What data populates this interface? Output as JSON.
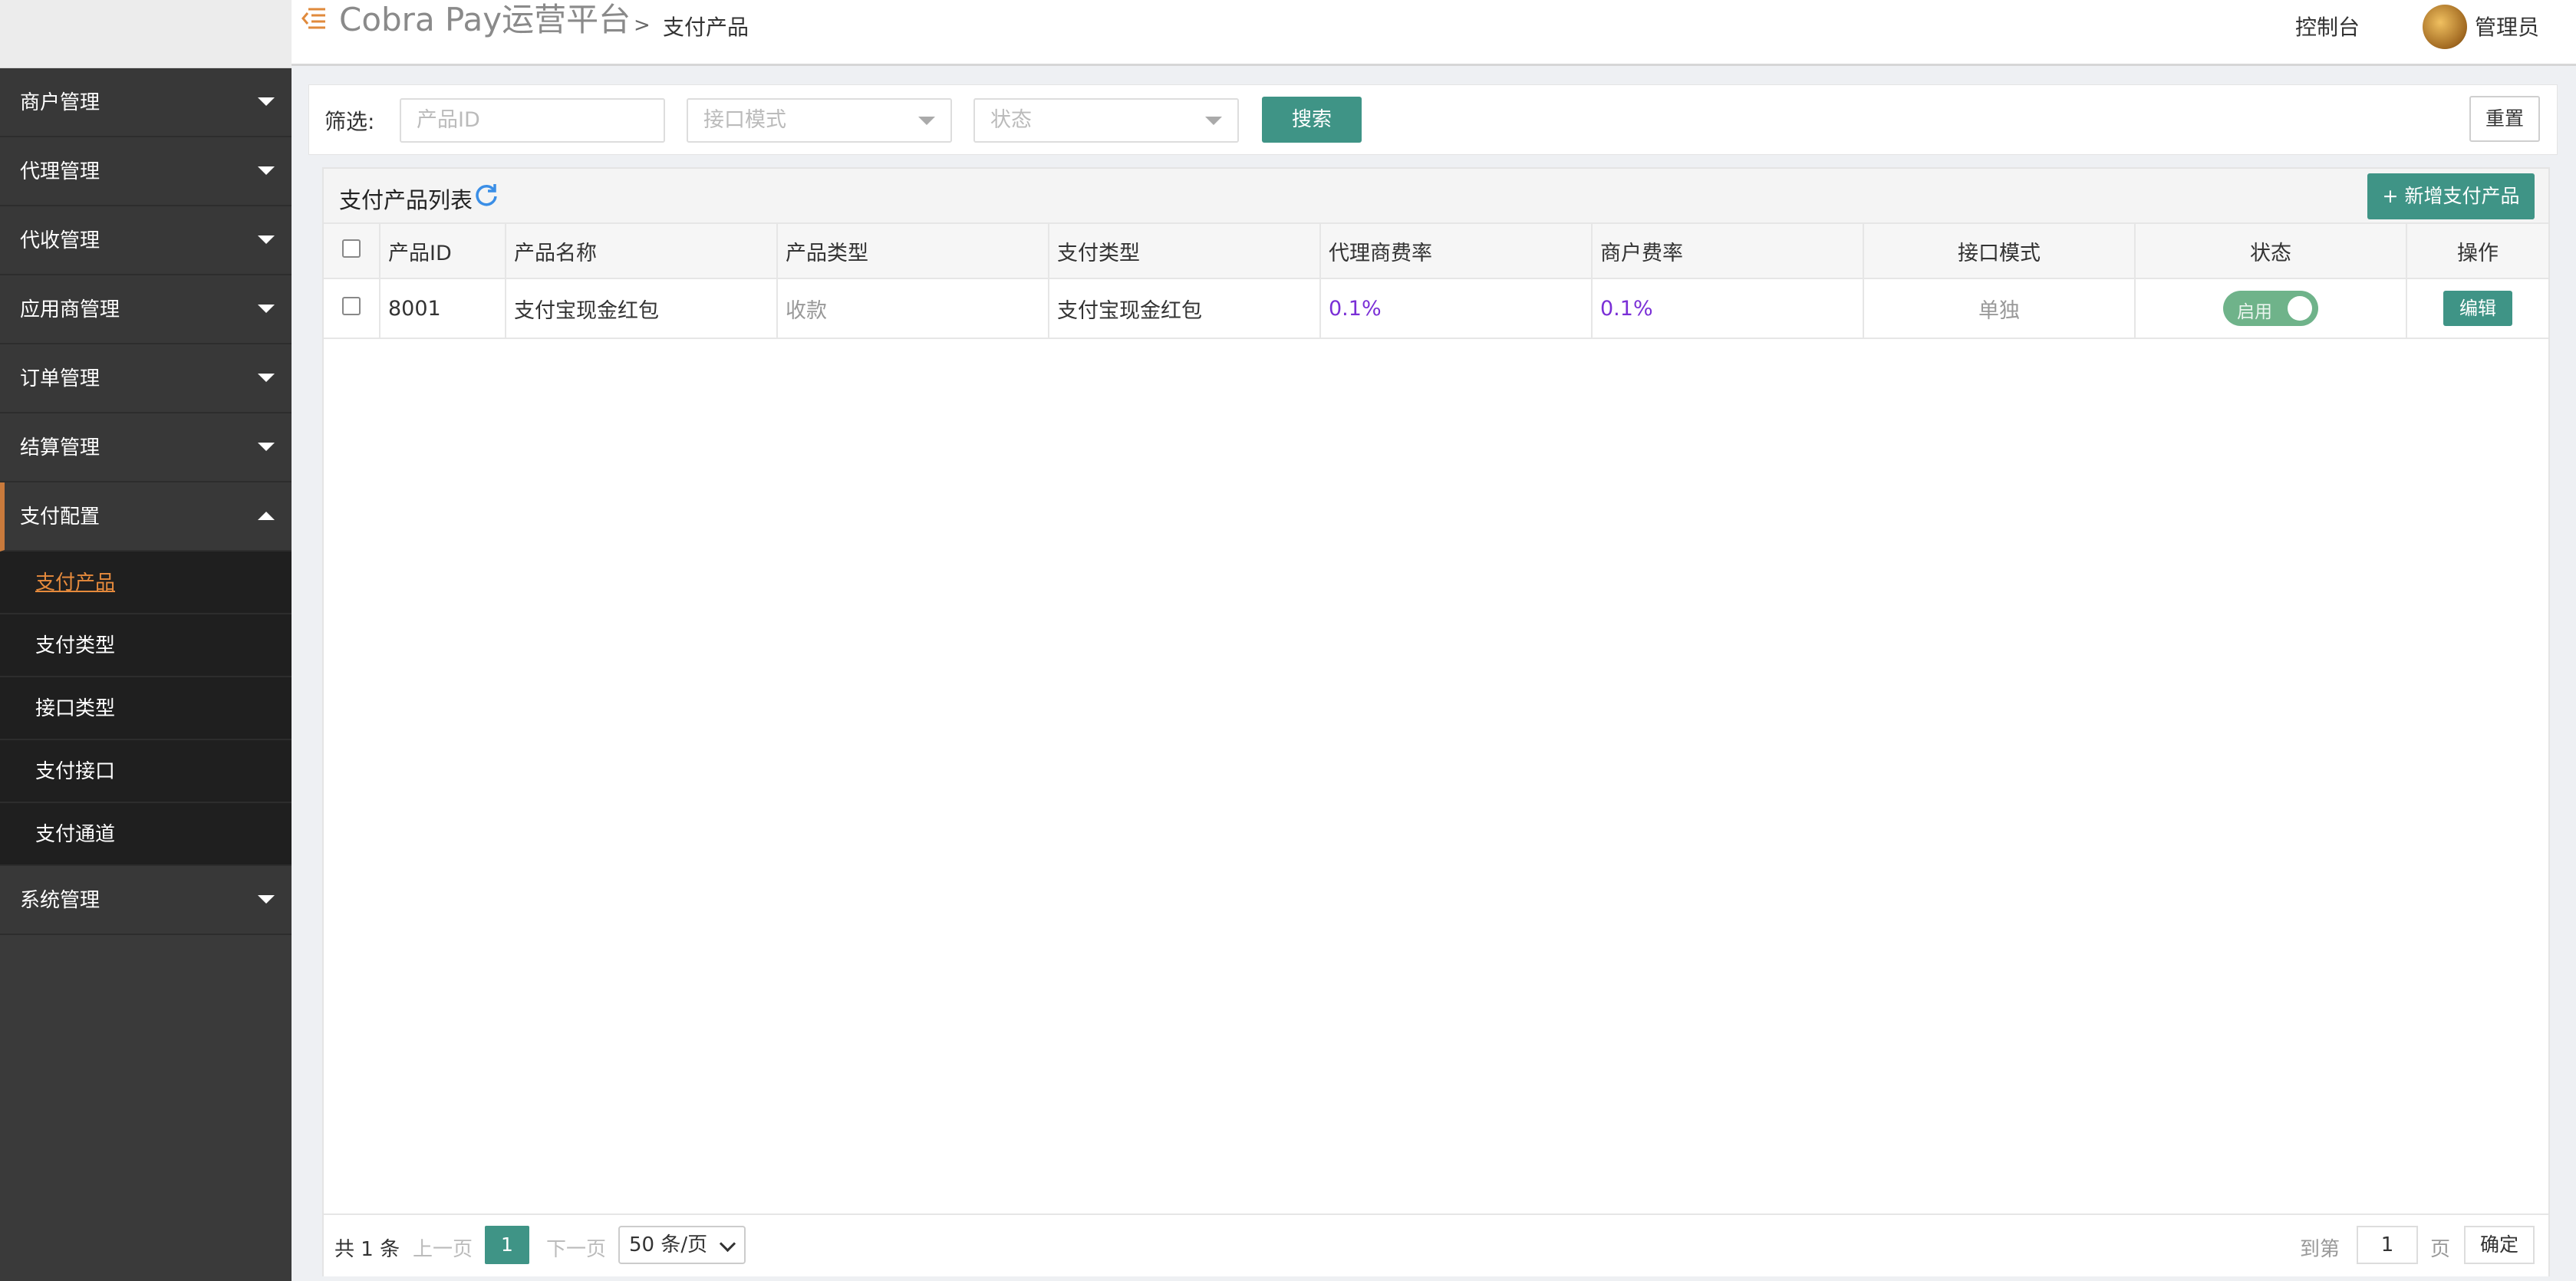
{
  "app": {
    "brand": "Cobra Pay运营平台",
    "breadcrumb_sep": ">",
    "breadcrumb": "支付产品",
    "console": "控制台",
    "user": "管理员"
  },
  "sidebar": {
    "items": [
      {
        "label": "商户管理"
      },
      {
        "label": "代理管理"
      },
      {
        "label": "代收管理"
      },
      {
        "label": "应用商管理"
      },
      {
        "label": "订单管理"
      },
      {
        "label": "结算管理"
      },
      {
        "label": "支付配置"
      }
    ],
    "sub_items": [
      {
        "label": "支付产品"
      },
      {
        "label": "支付类型"
      },
      {
        "label": "接口类型"
      },
      {
        "label": "支付接口"
      },
      {
        "label": "支付通道"
      }
    ],
    "last_item": {
      "label": "系统管理"
    }
  },
  "filter": {
    "label": "筛选:",
    "product_id_placeholder": "产品ID",
    "interface_mode_placeholder": "接口模式",
    "status_placeholder": "状态",
    "search": "搜索",
    "reset": "重置"
  },
  "panel": {
    "title": "支付产品列表",
    "add_button": "+ 新增支付产品"
  },
  "table": {
    "columns": [
      "产品ID",
      "产品名称",
      "产品类型",
      "支付类型",
      "代理商费率",
      "商户费率",
      "接口模式",
      "状态",
      "操作"
    ],
    "rows": [
      {
        "id": "8001",
        "name": "支付宝现金红包",
        "type": "收款",
        "pay_type": "支付宝现金红包",
        "agent_rate": "0.1%",
        "merchant_rate": "0.1%",
        "mode": "单独",
        "status": "启用",
        "action": "编辑"
      }
    ]
  },
  "pager": {
    "total": "共 1 条",
    "prev": "上一页",
    "current": "1",
    "next": "下一页",
    "page_size": "50 条/页",
    "goto": "到第",
    "goto_value": "1",
    "unit": "页",
    "ok": "确定"
  },
  "colors": {
    "accent": "#3f9486",
    "sidebar_bg": "#383838",
    "active_orange": "#e68a3c",
    "rate_purple": "#7a2fd6"
  }
}
